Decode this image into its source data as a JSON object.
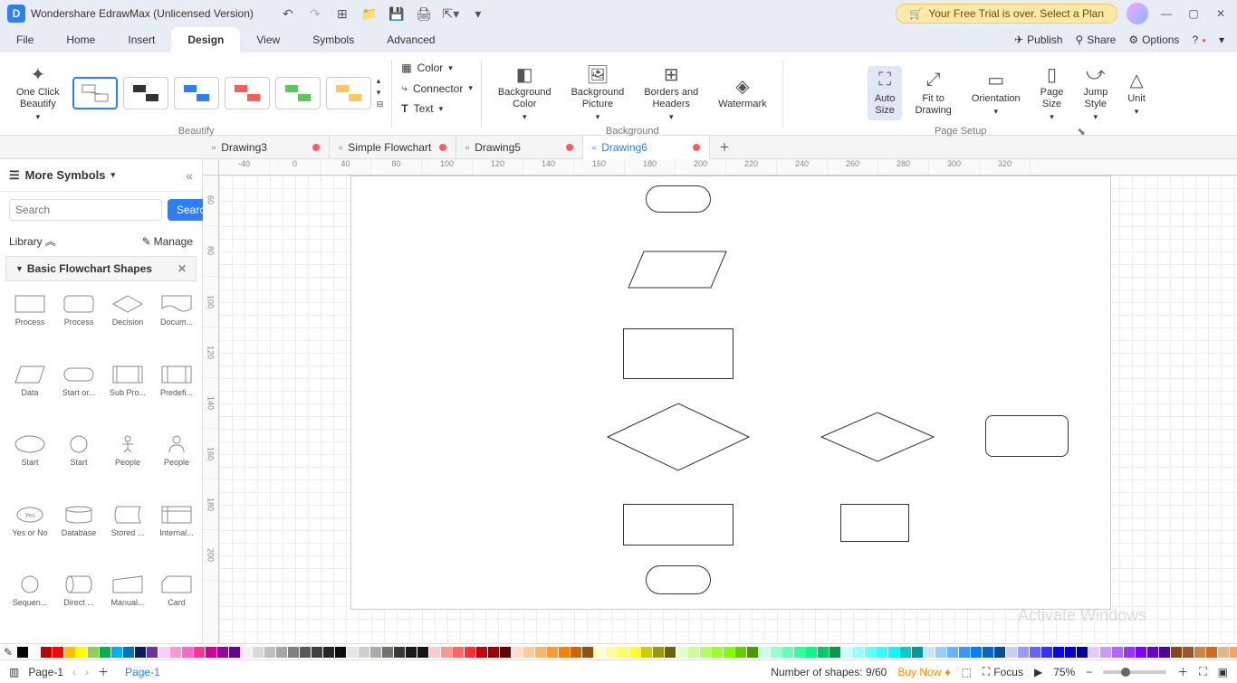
{
  "app": {
    "title": "Wondershare EdrawMax (Unlicensed Version)",
    "trial_message": "Your Free Trial is over. Select a Plan"
  },
  "menu": {
    "items": [
      "File",
      "Home",
      "Insert",
      "Design",
      "View",
      "Symbols",
      "Advanced"
    ],
    "active": "Design",
    "right": {
      "publish": "Publish",
      "share": "Share",
      "options": "Options"
    }
  },
  "ribbon": {
    "beautify": {
      "one_click": "One Click\nBeautify",
      "group": "Beautify"
    },
    "mini": {
      "color": "Color",
      "connector": "Connector",
      "text": "Text"
    },
    "background": {
      "bg_color": "Background\nColor",
      "bg_picture": "Background\nPicture",
      "borders": "Borders and\nHeaders",
      "watermark": "Watermark",
      "group": "Background"
    },
    "page_setup": {
      "auto_size": "Auto\nSize",
      "fit": "Fit to\nDrawing",
      "orientation": "Orientation",
      "page_size": "Page\nSize",
      "jump_style": "Jump\nStyle",
      "unit": "Unit",
      "group": "Page Setup"
    }
  },
  "doc_tabs": [
    {
      "name": "Drawing3",
      "dirty": true,
      "active": false
    },
    {
      "name": "Simple Flowchart",
      "dirty": true,
      "active": false
    },
    {
      "name": "Drawing5",
      "dirty": true,
      "active": false
    },
    {
      "name": "Drawing6",
      "dirty": true,
      "active": true
    }
  ],
  "sidebar": {
    "title": "More Symbols",
    "search_placeholder": "Search",
    "search_btn": "Search",
    "library": "Library",
    "manage": "Manage",
    "section": "Basic Flowchart Shapes",
    "shapes": [
      {
        "name": "Process"
      },
      {
        "name": "Process"
      },
      {
        "name": "Decision"
      },
      {
        "name": "Docum..."
      },
      {
        "name": "Data"
      },
      {
        "name": "Start or..."
      },
      {
        "name": "Sub Pro..."
      },
      {
        "name": "Predefi..."
      },
      {
        "name": "Start"
      },
      {
        "name": "Start"
      },
      {
        "name": "People"
      },
      {
        "name": "People"
      },
      {
        "name": "Yes or No"
      },
      {
        "name": "Database"
      },
      {
        "name": "Stored ..."
      },
      {
        "name": "Internal..."
      },
      {
        "name": "Sequen..."
      },
      {
        "name": "Direct ..."
      },
      {
        "name": "Manual..."
      },
      {
        "name": "Card"
      }
    ]
  },
  "ruler_h": [
    "-40",
    "0",
    "40",
    "80",
    "100",
    "120",
    "140",
    "160",
    "180",
    "200",
    "220",
    "240",
    "260",
    "280",
    "300",
    "320"
  ],
  "ruler_v": [
    "60",
    "80",
    "100",
    "120",
    "140",
    "160",
    "180",
    "200"
  ],
  "status": {
    "page": "Page-1",
    "page_tab": "Page-1",
    "shapes": "Number of shapes: 9/60",
    "buy": "Buy Now",
    "focus": "Focus",
    "zoom": "75%"
  },
  "watermark": "Activate Windows",
  "colors": [
    "#000000",
    "#ffffff",
    "#c00000",
    "#ff0000",
    "#ffc000",
    "#ffff00",
    "#92d050",
    "#00b050",
    "#00b0f0",
    "#0070c0",
    "#002060",
    "#7030a0",
    "#ffccff",
    "#ff99cc",
    "#ff66cc",
    "#ff3399",
    "#cc0099",
    "#990099",
    "#660099",
    "#f2f2f2",
    "#d9d9d9",
    "#bfbfbf",
    "#a6a6a6",
    "#808080",
    "#595959",
    "#404040",
    "#262626",
    "#0d0d0d",
    "#e7e6e6",
    "#d0cece",
    "#aeaaaa",
    "#767171",
    "#3b3838",
    "#1b1a1a",
    "#161616",
    "#ffcccc",
    "#ff9999",
    "#ff6666",
    "#ff3333",
    "#cc0000",
    "#990000",
    "#660000",
    "#ffe0cc",
    "#ffcc99",
    "#ffb366",
    "#ff9933",
    "#ff8000",
    "#cc6600",
    "#994d00",
    "#ffffcc",
    "#ffff99",
    "#ffff66",
    "#ffff33",
    "#cccc00",
    "#999900",
    "#666600",
    "#e5ffcc",
    "#ccff99",
    "#b3ff66",
    "#99ff33",
    "#80ff00",
    "#66cc00",
    "#4d9900",
    "#ccffe5",
    "#99ffcc",
    "#66ffb3",
    "#33ff99",
    "#00ff80",
    "#00cc66",
    "#00994d",
    "#ccffff",
    "#99ffff",
    "#66ffff",
    "#33ffff",
    "#00ffff",
    "#00cccc",
    "#009999",
    "#cce5ff",
    "#99ccff",
    "#66b3ff",
    "#3399ff",
    "#0080ff",
    "#0066cc",
    "#004d99",
    "#ccccff",
    "#9999ff",
    "#6666ff",
    "#3333ff",
    "#0000ff",
    "#0000cc",
    "#000099",
    "#e5ccff",
    "#cc99ff",
    "#b366ff",
    "#9933ff",
    "#8000ff",
    "#6600cc",
    "#4d0099",
    "#8b4513",
    "#a0522d",
    "#cd853f",
    "#d2691e",
    "#deb887",
    "#f4a460"
  ]
}
